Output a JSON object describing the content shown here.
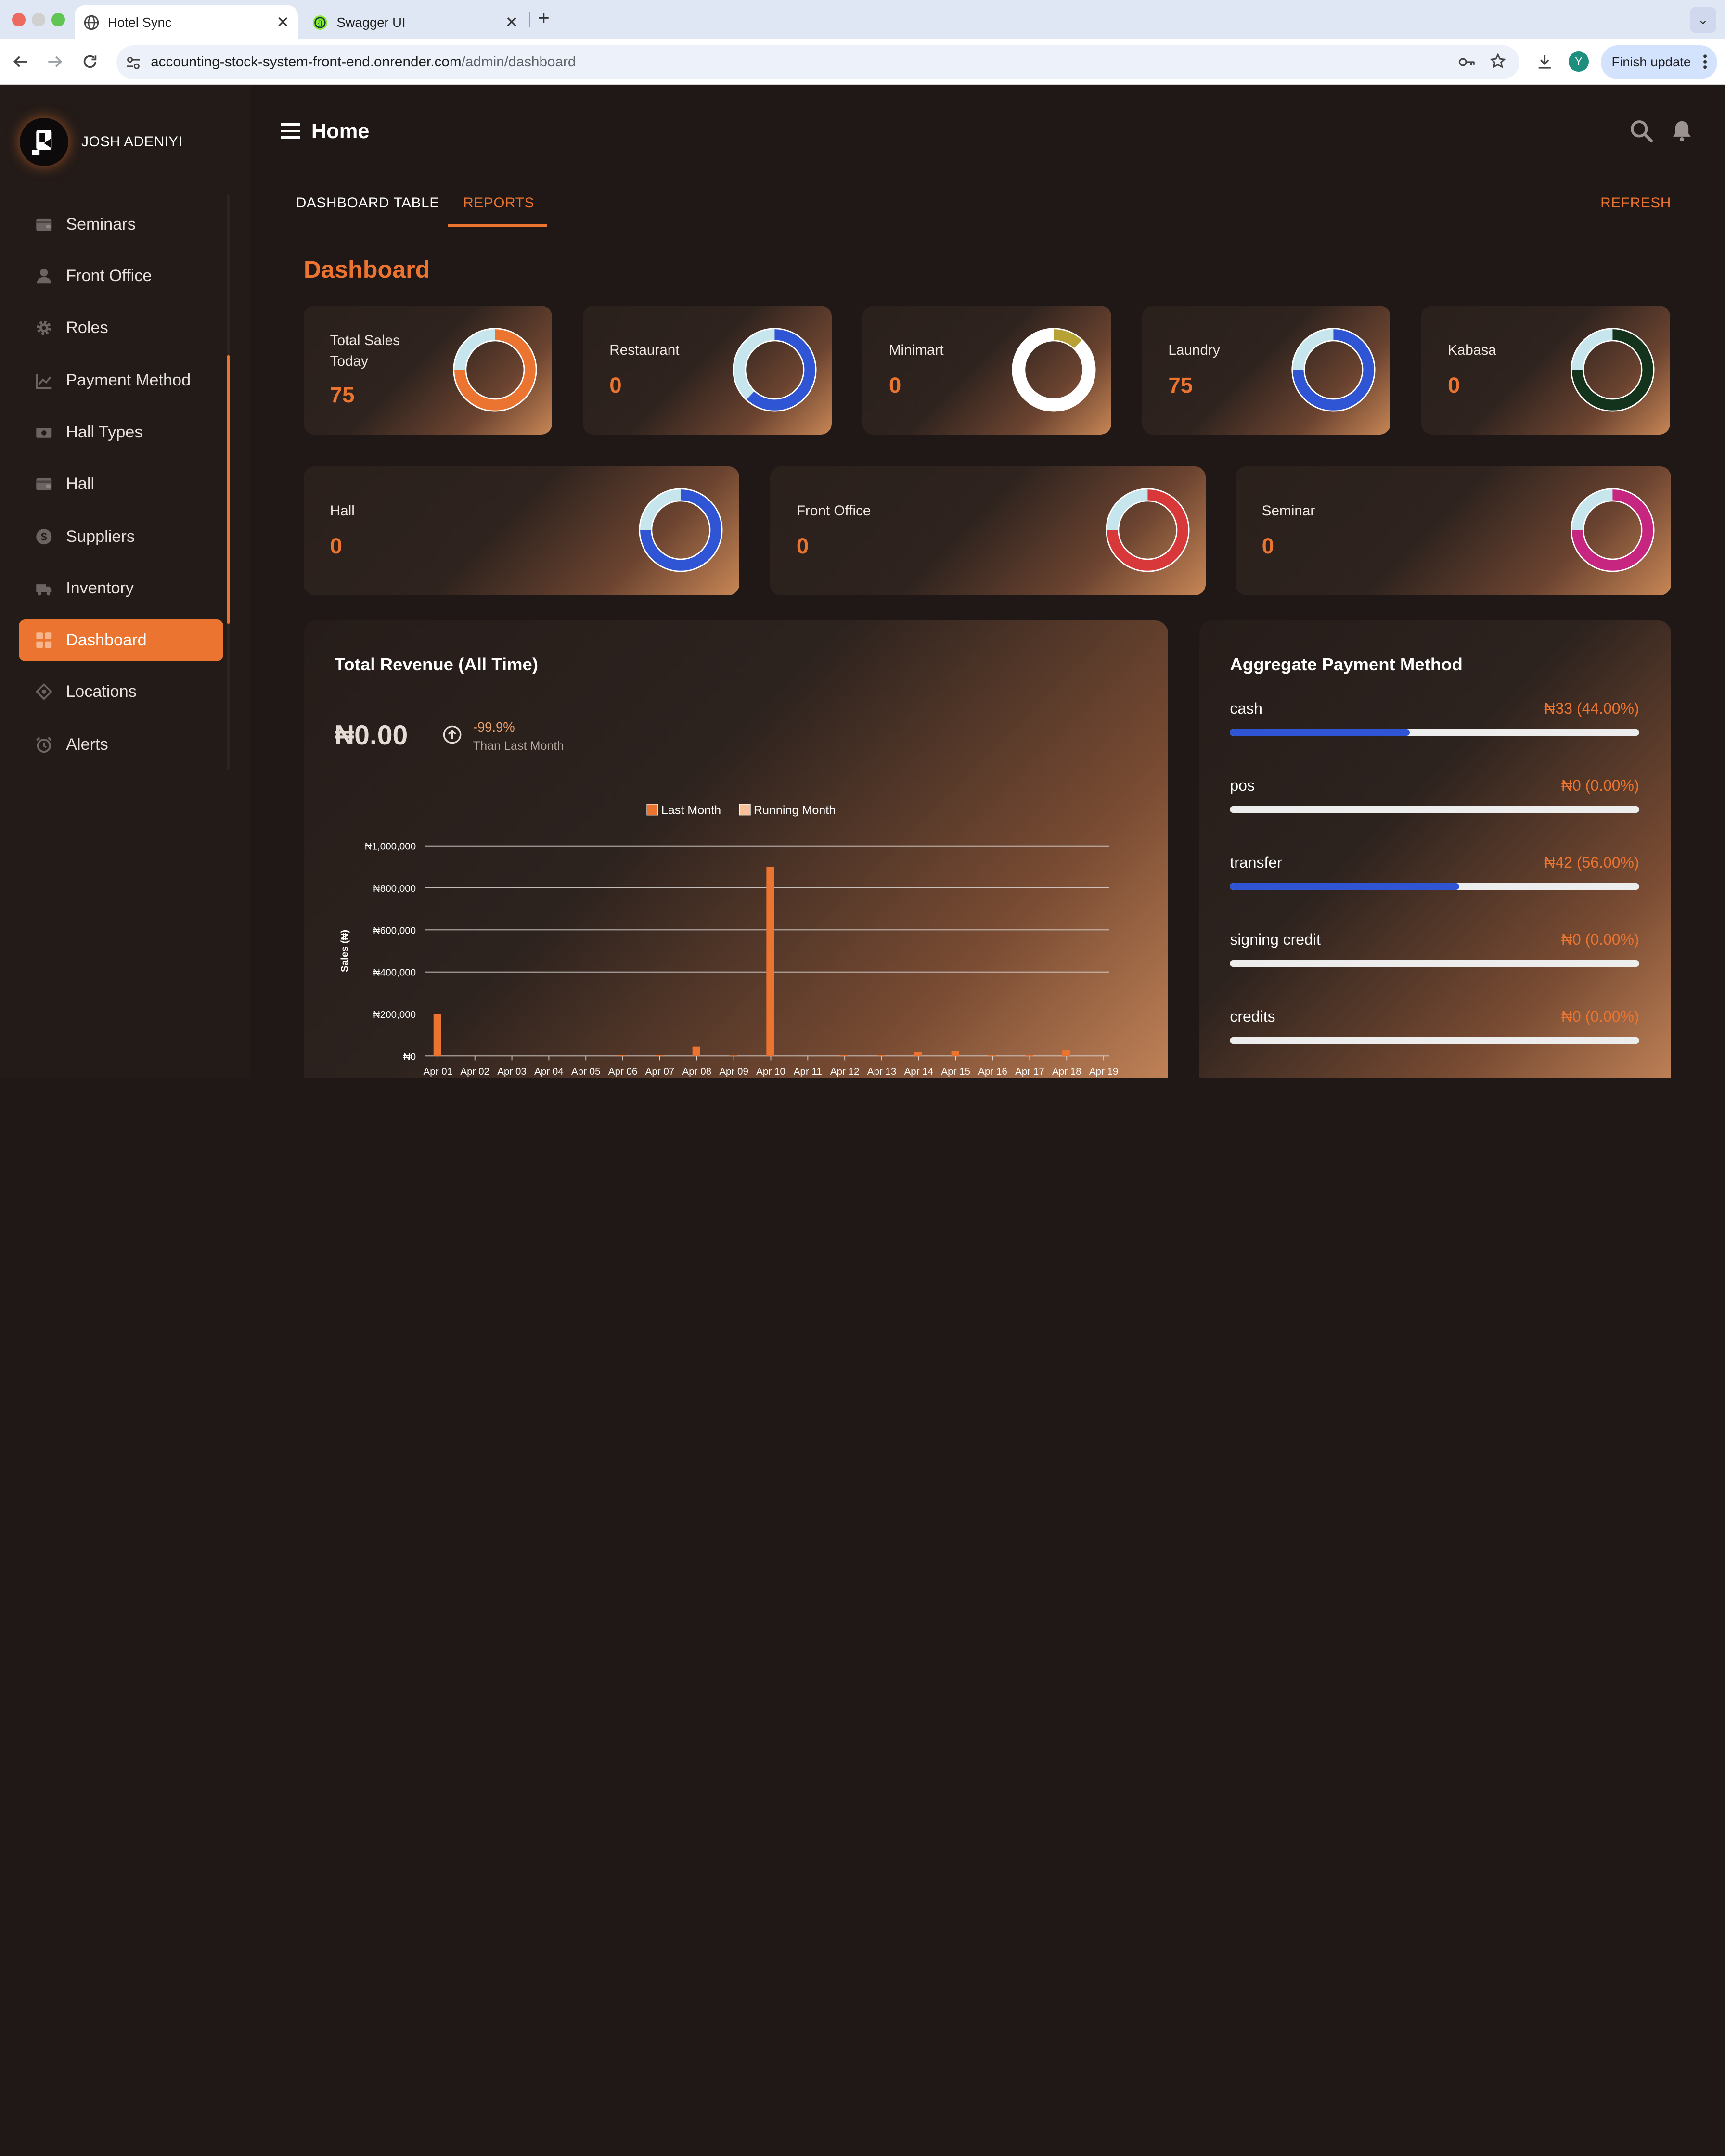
{
  "browser": {
    "tabs": [
      {
        "title": "Hotel Sync",
        "active": true
      },
      {
        "title": "Swagger UI",
        "active": false
      }
    ],
    "url_host": "accounting-stock-system-front-end.onrender.com",
    "url_path": "/admin/dashboard",
    "profile_initial": "Y",
    "finish_update_label": "Finish update"
  },
  "sidebar": {
    "user_name": "JOSH ADENIYI",
    "items": [
      {
        "label": "Seminars",
        "icon": "wallet-icon"
      },
      {
        "label": "Front Office",
        "icon": "person-icon"
      },
      {
        "label": "Roles",
        "icon": "gear-icon"
      },
      {
        "label": "Payment Method",
        "icon": "line-chart-icon"
      },
      {
        "label": "Hall Types",
        "icon": "cash-icon"
      },
      {
        "label": "Hall",
        "icon": "wallet-icon"
      },
      {
        "label": "Suppliers",
        "icon": "dollar-circle-icon"
      },
      {
        "label": "Inventory",
        "icon": "truck-icon"
      },
      {
        "label": "Dashboard",
        "icon": "grid-icon",
        "active": true
      },
      {
        "label": "Locations",
        "icon": "location-icon"
      },
      {
        "label": "Alerts",
        "icon": "alarm-icon"
      }
    ]
  },
  "header": {
    "title": "Home"
  },
  "tabs": {
    "dashboard_table": "DASHBOARD TABLE",
    "reports": "REPORTS",
    "refresh": "REFRESH"
  },
  "dashboard_title": "Dashboard",
  "stat_cards": [
    {
      "label": "Total Sales Today",
      "value": "75",
      "ring_color": "#ea7430",
      "fill_fraction": 0.75
    },
    {
      "label": "Restaurant",
      "value": "0",
      "ring_color": "#2f55d4",
      "fill_fraction": 0.62
    },
    {
      "label": "Minimart",
      "value": "0",
      "ring_color": "#b8a236",
      "fill_fraction": 0.12,
      "rest_color": "#ffffff"
    },
    {
      "label": "Laundry",
      "value": "75",
      "ring_color": "#2f55d4",
      "fill_fraction": 0.75
    },
    {
      "label": "Kabasa",
      "value": "0",
      "ring_color": "#14331d",
      "fill_fraction": 0.75
    },
    {
      "label": "Hall",
      "value": "0",
      "ring_color": "#2f55d4",
      "fill_fraction": 0.75
    },
    {
      "label": "Front Office",
      "value": "0",
      "ring_color": "#d9383a",
      "fill_fraction": 0.75
    },
    {
      "label": "Seminar",
      "value": "0",
      "ring_color": "#c6267f",
      "fill_fraction": 0.75
    }
  ],
  "revenue": {
    "title": "Total Revenue (All Time)",
    "amount": "₦0.00",
    "change": "-99.9%",
    "change_label": "Than Last Month"
  },
  "chart_data": {
    "type": "bar",
    "ylabel": "Sales (₦)",
    "xlabel": "",
    "ylim": [
      0,
      1000000
    ],
    "yticks": [
      "₦0",
      "₦200,000",
      "₦400,000",
      "₦600,000",
      "₦800,000",
      "₦1,000,000"
    ],
    "categories": [
      "Apr 01",
      "Apr 02",
      "Apr 03",
      "Apr 04",
      "Apr 05",
      "Apr 06",
      "Apr 07",
      "Apr 08",
      "Apr 09",
      "Apr 10",
      "Apr 11",
      "Apr 12",
      "Apr 13",
      "Apr 14",
      "Apr 15",
      "Apr 16",
      "Apr 17",
      "Apr 18",
      "Apr 19"
    ],
    "series": [
      {
        "name": "Last Month",
        "color": "#ea7430",
        "values": [
          200000,
          0,
          0,
          0,
          0,
          3000,
          5000,
          45000,
          2000,
          900000,
          0,
          3000,
          5000,
          18000,
          25000,
          5000,
          3000,
          28000,
          0
        ]
      },
      {
        "name": "Running Month",
        "color": "#f7c29b",
        "values": [
          0,
          0,
          0,
          0,
          0,
          0,
          0,
          0,
          0,
          0,
          0,
          0,
          0,
          0,
          0,
          0,
          0,
          0,
          0
        ]
      }
    ],
    "grid": true,
    "legend": "top-center"
  },
  "payment_methods": {
    "title": "Aggregate Payment Method",
    "items": [
      {
        "name": "cash",
        "value": "₦33 (44.00%)",
        "fraction": 0.44
      },
      {
        "name": "pos",
        "value": "₦0 (0.00%)",
        "fraction": 0
      },
      {
        "name": "transfer",
        "value": "₦42 (56.00%)",
        "fraction": 0.56
      },
      {
        "name": "signing credit",
        "value": "₦0 (0.00%)",
        "fraction": 0
      },
      {
        "name": "credits",
        "value": "₦0 (0.00%)",
        "fraction": 0
      }
    ]
  }
}
